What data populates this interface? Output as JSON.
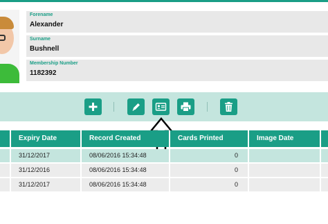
{
  "member": {
    "forename_label": "Forename",
    "forename": "Alexander",
    "surname_label": "Surname",
    "surname": "Bushnell",
    "membership_label": "Membership Number",
    "membership_number": "1182392"
  },
  "toolbar": {
    "buttons": [
      {
        "name": "add",
        "icon": "plus-icon"
      },
      {
        "name": "edit",
        "icon": "pencil-icon"
      },
      {
        "name": "id-card",
        "icon": "id-card-icon"
      },
      {
        "name": "print",
        "icon": "printer-icon"
      },
      {
        "name": "delete",
        "icon": "trash-icon"
      }
    ]
  },
  "table": {
    "headers": [
      "",
      "Expiry Date",
      "Record Created",
      "Cards Printed",
      "Image Date",
      ""
    ],
    "rows": [
      {
        "expiry": "31/12/2017",
        "created": "08/06/2016 15:34:48",
        "printed": "0",
        "image_date": ""
      },
      {
        "expiry": "31/12/2016",
        "created": "08/06/2016 15:34:48",
        "printed": "0",
        "image_date": ""
      },
      {
        "expiry": "31/12/2017",
        "created": "08/06/2016 15:34:48",
        "printed": "0",
        "image_date": ""
      }
    ]
  },
  "colors": {
    "accent": "#1a9e86",
    "toolbar_bg": "#c4e5de",
    "field_bg": "#e8e8e8",
    "row_highlight": "#c4e5de",
    "row_bg": "#ececec"
  }
}
